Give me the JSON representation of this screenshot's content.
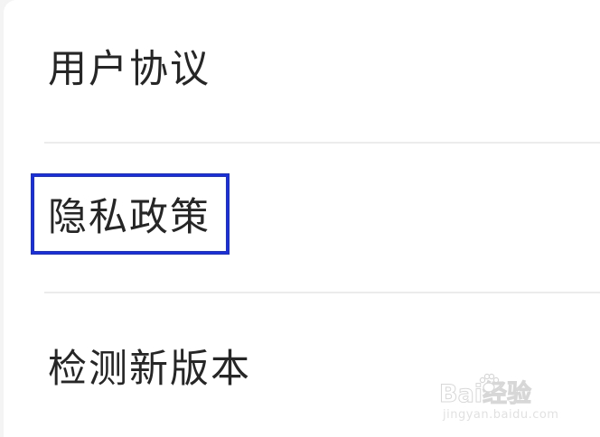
{
  "menu": {
    "items": [
      {
        "label": "用户协议"
      },
      {
        "label": "隐私政策"
      },
      {
        "label": "检测新版本"
      }
    ],
    "highlighted_index": 1,
    "highlight_color": "#1a2fd6"
  },
  "watermark": {
    "brand": "Bai经验",
    "url": "jingyan.baidu.com"
  }
}
